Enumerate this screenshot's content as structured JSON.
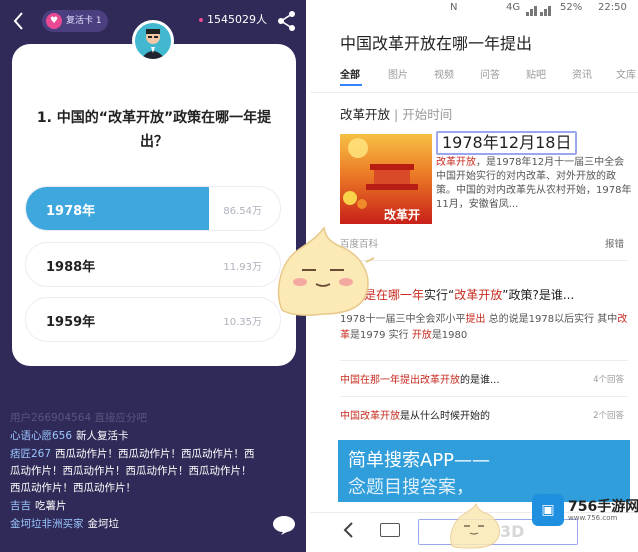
{
  "left": {
    "revive_card": "复活卡 1",
    "player_count": "1545029人",
    "question": "1. 中国的“改革开放”政策在哪一年提出？",
    "options": [
      {
        "label": "1978年",
        "count": "86.54万",
        "fraction": 0.72,
        "selected": true
      },
      {
        "label": "1988年",
        "count": "11.93万",
        "fraction": 0,
        "selected": false
      },
      {
        "label": "1959年",
        "count": "10.35万",
        "fraction": 0,
        "selected": false
      }
    ],
    "comments": [
      {
        "name": "用户266904564",
        "text": "直接应分吧",
        "faded": true
      },
      {
        "name": "心语心愿656",
        "text": "新人复活卡",
        "faded": false
      },
      {
        "name": "痞匠267",
        "text": "西瓜动作片！西瓜动作片！西瓜动作片！西瓜动作片！西瓜动作片！西瓜动作片！西瓜动作片！西瓜动作片！西瓜动作片！",
        "faded": false
      },
      {
        "name": "吉吉",
        "text": "吃薯片",
        "faded": false
      },
      {
        "name": "金坷垃非洲买家",
        "text": "金坷垃",
        "faded": false
      }
    ]
  },
  "right": {
    "status": {
      "signal": "N",
      "network": "4G",
      "battery": "52%",
      "time": "22:50"
    },
    "search_query": "中国改革开放在哪一年提出",
    "tabs": [
      "全部",
      "图片",
      "视频",
      "问答",
      "贴吧",
      "资讯",
      "文库"
    ],
    "kw_main": "改革开放",
    "kw_sub": "| 开始时间",
    "answer_date": "1978年12月18日",
    "thumb_text": "改革开",
    "snippet_parts": [
      {
        "t": "改革开放",
        "hl": true
      },
      {
        "t": "，是1978年12月十一届三中全会中国开始实行的对内改革、对外开放的政策。中国的对内改革先从农村开始，1978年11月，安徽省凤...",
        "hl": false
      }
    ],
    "source": "百度百科",
    "report": "报错",
    "result": {
      "title_parts": [
        {
          "t": "中国是在哪一年",
          "hl": true
        },
        {
          "t": "实行“",
          "hl": false
        },
        {
          "t": "改革开放",
          "hl": true
        },
        {
          "t": "”政策?是谁...",
          "hl": false
        }
      ],
      "desc_parts": [
        {
          "t": "1978十一届三中全会邓小平",
          "hl": false
        },
        {
          "t": "提出",
          "hl": true
        },
        {
          "t": " 总的说是1978以后实行 其中",
          "hl": false
        },
        {
          "t": "改革",
          "hl": true
        },
        {
          "t": "是1979 实行 ",
          "hl": false
        },
        {
          "t": "开放",
          "hl": true
        },
        {
          "t": "是1980",
          "hl": false
        }
      ]
    },
    "related": [
      {
        "parts": [
          {
            "t": "中国在那一年提出改革开放",
            "hl": true
          },
          {
            "t": "的是谁...",
            "hl": false
          }
        ],
        "count": "4个回答"
      },
      {
        "parts": [
          {
            "t": "中国改革开放",
            "hl": true
          },
          {
            "t": "是从什么时候开始的",
            "hl": false
          }
        ],
        "count": "2个回答"
      }
    ],
    "banner_line1": "简单搜索APP——",
    "banner_line2": "念题目搜答案，"
  },
  "watermark": {
    "brand": "756手游网",
    "sub": "www.756.com",
    "faint": "3D"
  },
  "colors": {
    "accent": "#3ea7de",
    "brand_pink": "#e94a93",
    "highlight": "#c72b20",
    "left_bg": "#2f2a57"
  }
}
